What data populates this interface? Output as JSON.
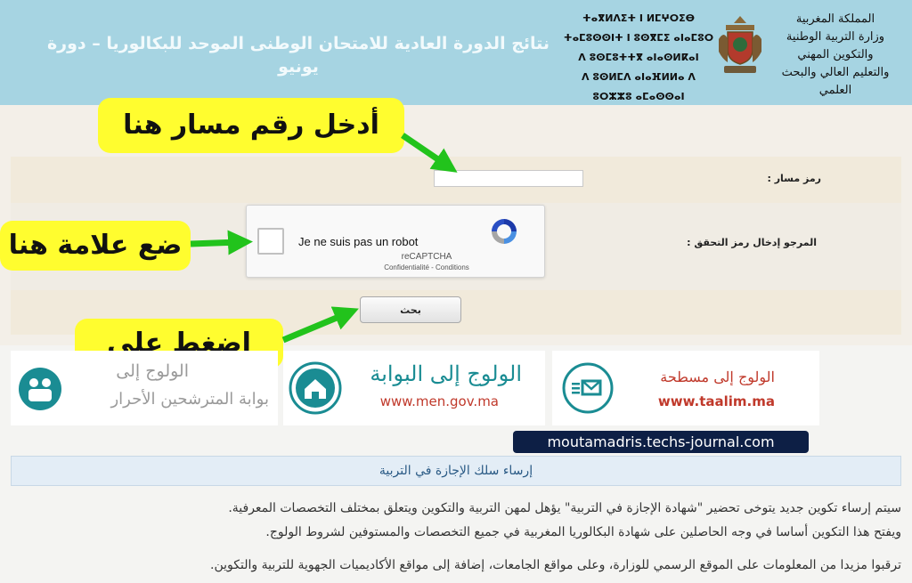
{
  "header": {
    "title": "نتائج الدورة العادية للامتحان الوطنى الموحد للبكالوريا – دورة يونيو",
    "ministry_lines": [
      "المملكة المغربية",
      "وزارة التربية الوطنية",
      "والتكوين المهني",
      "والتعليم العالي والبحث العلمي"
    ],
    "tifinagh_lines": [
      "ⵜⴰⴳⵍⴷⵉⵜ ⵏ ⵍⵎⵖⵔⵉⴱ",
      "ⵜⴰⵎⵓⵙⵙⵏⵜ ⵏ ⵓⵙⴳⵎⵉ ⴰⵏⴰⵎⵓⵔ",
      "ⴷ ⵓⵙⵎⵓⵜⵜⴳ ⴰⵏⴰⵙⵍⴽⴰⵏ",
      "ⴷ ⵓⵙⵍⵎⴷ ⴰⵏⴰⴼⵍⵍⴰ ⴷ ⵓⵔⵣⵣⵓ ⴰⵎⴰⵙⵙⴰⵏ"
    ],
    "bg_color": "#a6d4e2"
  },
  "form": {
    "code_label": "رمز مسار :",
    "captcha_label": "المرجو إدخال رمز التحقق :",
    "search_button": "بحث",
    "code_value": ""
  },
  "captcha": {
    "text": "Je ne suis pas un robot",
    "brand": "reCAPTCHA",
    "links": "Confidentialité - Conditions"
  },
  "annotations": {
    "enter_code": "أدخل رقم مسار هنا",
    "check_here": "ضع علامة هنا",
    "click_search": "اضغط على بحث",
    "highlight_color": "#fffd2f",
    "arrow_color": "#22c31c"
  },
  "banners": {
    "candidates": [
      "الولوج إلى",
      "بوابة المترشحين الأحرار"
    ],
    "men": [
      "الولوج إلى البوابة",
      "www.men.gov.ma"
    ],
    "taalim": [
      "الولوج إلى مسطحة",
      "www.taalim.ma"
    ]
  },
  "watermark": "moutamadris.techs-journal.com",
  "section": {
    "title": "إرساء سلك الإجازة في التربية",
    "para1": "سيتم إرساء تكوين جديد يتوخى تحضير \"شهادة الإجازة في التربية\" يؤهل لمهن التربية والتكوين ويتعلق بمختلف التخصصات المعرفية.",
    "para2": "ويفتح هذا التكوين أساسا في وجه الحاصلين على شهادة البكالوريا المغربية في جميع التخصصات والمستوفين لشروط الولوج.",
    "para3": "ترقبوا مزيدا من المعلومات على الموقع الرسمي للوزارة، وعلى مواقع الجامعات، إضافة إلى مواقع الأكاديميات الجهوية للتربية والتكوين."
  }
}
